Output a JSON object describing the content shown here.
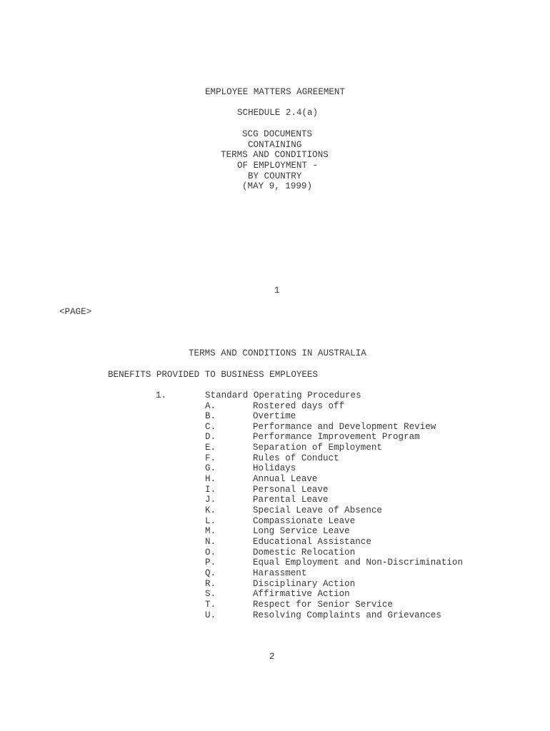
{
  "page1": {
    "title": "EMPLOYEE MATTERS AGREEMENT",
    "schedule": "SCHEDULE 2.4(a)",
    "subtitle_lines": [
      "SCG DOCUMENTS",
      "CONTAINING",
      "TERMS AND CONDITIONS",
      "OF EMPLOYMENT -",
      "BY COUNTRY",
      "(MAY 9, 1999)"
    ],
    "page_number": "1"
  },
  "page_marker": "<PAGE>",
  "page2": {
    "heading": "TERMS AND CONDITIONS IN AUSTRALIA",
    "subheading": "BENEFITS PROVIDED TO BUSINESS EMPLOYEES",
    "section_number": "1.",
    "section_title": "Standard Operating Procedures",
    "items": [
      {
        "letter": "A.",
        "text": "Rostered days off"
      },
      {
        "letter": "B.",
        "text": "Overtime"
      },
      {
        "letter": "C.",
        "text": "Performance and Development Review"
      },
      {
        "letter": "D.",
        "text": "Performance Improvement Program"
      },
      {
        "letter": "E.",
        "text": "Separation of Employment"
      },
      {
        "letter": "F.",
        "text": "Rules of Conduct"
      },
      {
        "letter": "G.",
        "text": "Holidays"
      },
      {
        "letter": "H.",
        "text": "Annual Leave"
      },
      {
        "letter": "I.",
        "text": "Personal Leave"
      },
      {
        "letter": "J.",
        "text": "Parental Leave"
      },
      {
        "letter": "K.",
        "text": "Special Leave of Absence"
      },
      {
        "letter": "L.",
        "text": "Compassionate Leave"
      },
      {
        "letter": "M.",
        "text": "Long Service Leave"
      },
      {
        "letter": "N.",
        "text": "Educational Assistance"
      },
      {
        "letter": "O.",
        "text": "Domestic Relocation"
      },
      {
        "letter": "P.",
        "text": "Equal Employment and Non-Discrimination"
      },
      {
        "letter": "Q.",
        "text": "Harassment"
      },
      {
        "letter": "R.",
        "text": "Disciplinary Action"
      },
      {
        "letter": "S.",
        "text": "Affirmative Action"
      },
      {
        "letter": "T.",
        "text": "Respect for Senior Service"
      },
      {
        "letter": "U.",
        "text": "Resolving Complaints and Grievances"
      }
    ],
    "page_number": "2"
  }
}
